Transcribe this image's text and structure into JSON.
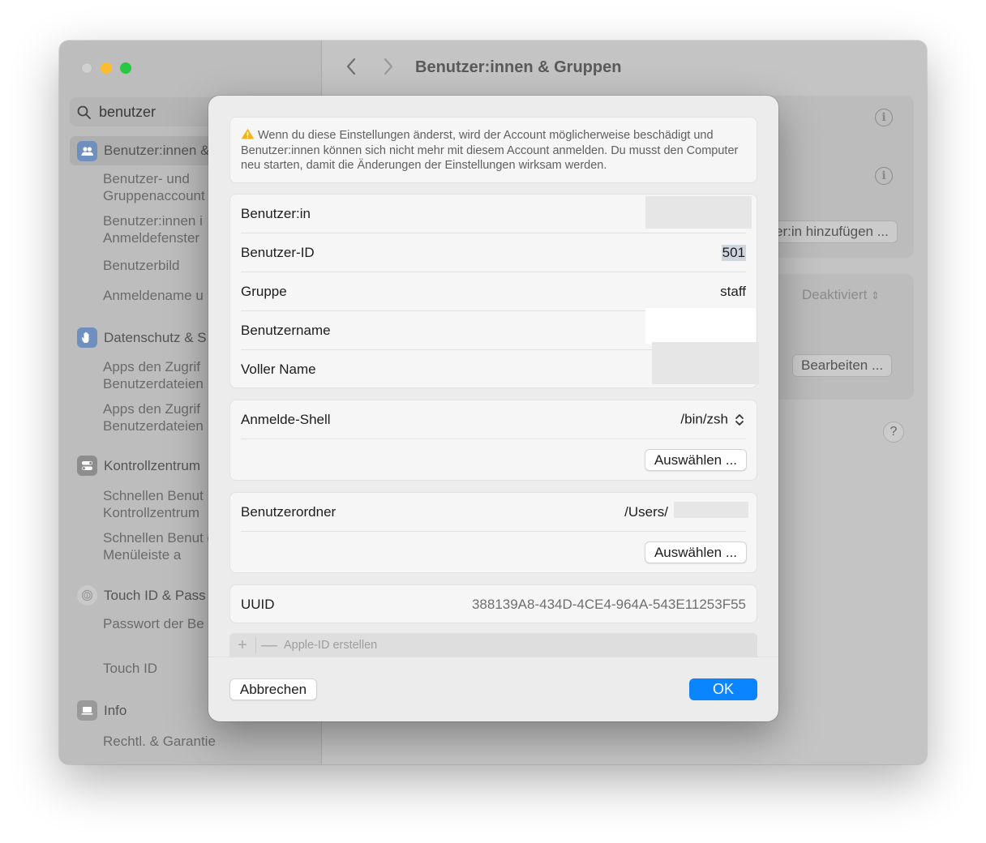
{
  "window": {
    "title": "Benutzer:innen & Gruppen"
  },
  "sidebar": {
    "search_value": "benutzer",
    "groups": [
      {
        "label": "Benutzer:innen &",
        "items": [
          "Benutzer- und Gruppenaccount",
          "Benutzer:innen i Anmeldefenster",
          "Benutzerbild",
          "Anmeldename u"
        ]
      },
      {
        "label": "Datenschutz & S",
        "items": [
          "Apps den Zugrif Benutzerdateien",
          "Apps den Zugrif Benutzerdateien"
        ]
      },
      {
        "label": "Kontrollzentrum",
        "items": [
          "Schnellen Benut Kontrollzentrum",
          "Schnellen Benut der Menüleiste a"
        ]
      },
      {
        "label": "Touch ID & Pass",
        "items": [
          "Passwort der Be ändern",
          "Touch ID"
        ]
      },
      {
        "label": "Info",
        "items": [
          "Rechtl. & Garantie"
        ]
      }
    ]
  },
  "background": {
    "add_user_label": "er:in hinzufügen ...",
    "deactivated_value": "Deaktiviert",
    "edit_label": "Bearbeiten ...",
    "help_label": "?"
  },
  "dialog": {
    "warning": "Wenn du diese Einstellungen änderst, wird der Account möglicherweise beschädigt und Benutzer:innen können sich nicht mehr mit diesem Account anmelden. Du musst den Computer neu starten, damit die Änderungen der Einstellungen wirksam werden.",
    "fields": {
      "user_label": "Benutzer:in",
      "user_id_label": "Benutzer-ID",
      "user_id_value": "501",
      "group_label": "Gruppe",
      "group_value": "staff",
      "username_label": "Benutzername",
      "fullname_label": "Voller Name"
    },
    "shell": {
      "label": "Anmelde-Shell",
      "value": "/bin/zsh",
      "choose_label": "Auswählen ..."
    },
    "home": {
      "label": "Benutzerordner",
      "value": "/Users/",
      "choose_label": "Auswählen ..."
    },
    "uuid": {
      "label": "UUID",
      "value": "388139A8-434D-4CE4-964A-543E11253F55"
    },
    "bottom_bar": {
      "add_symbol": "+",
      "remove_symbol": "—",
      "apple_id_label": "Apple-ID erstellen"
    },
    "cancel_label": "Abbrechen",
    "ok_label": "OK"
  },
  "colors": {
    "accent": "#0a84ff",
    "warning": "#f5b416"
  }
}
